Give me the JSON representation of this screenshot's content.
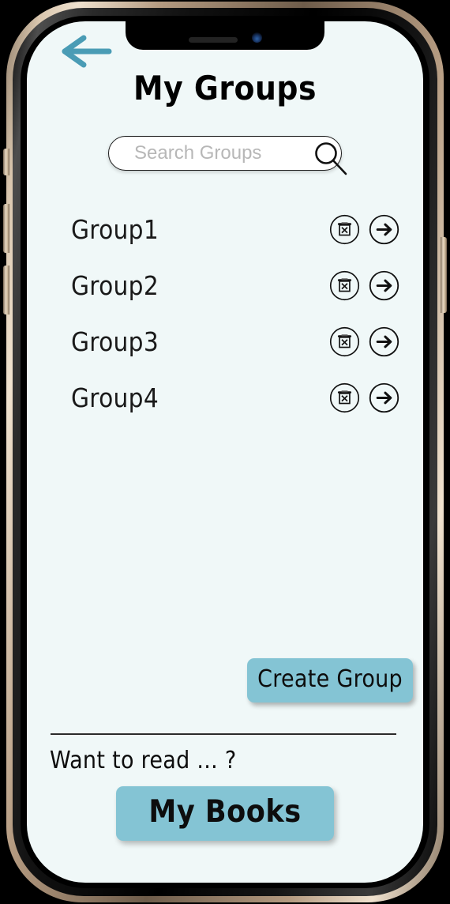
{
  "device": {
    "type": "smartphone-mockup",
    "notch": {
      "speaker": "earpiece-speaker",
      "camera": "front-camera"
    },
    "buttons": [
      "silent-switch",
      "volume-up",
      "volume-down",
      "power"
    ]
  },
  "colors": {
    "screen_background": "#f0f8f8",
    "accent_button": "#84c4d4",
    "back_arrow": "#4a9cb5",
    "text": "#0d0d0d",
    "placeholder": "#b7b7b7"
  },
  "header": {
    "back_label": "Back",
    "title": "My Groups"
  },
  "search": {
    "value": "",
    "placeholder": "Search Groups",
    "icon": "search-icon"
  },
  "groups": [
    {
      "name": "Group1",
      "delete_icon": "trash-delete-icon",
      "open_icon": "arrow-right-icon"
    },
    {
      "name": "Group2",
      "delete_icon": "trash-delete-icon",
      "open_icon": "arrow-right-icon"
    },
    {
      "name": "Group3",
      "delete_icon": "trash-delete-icon",
      "open_icon": "arrow-right-icon"
    },
    {
      "name": "Group4",
      "delete_icon": "trash-delete-icon",
      "open_icon": "arrow-right-icon"
    }
  ],
  "actions": {
    "create_group_label": "Create Group"
  },
  "footer": {
    "prompt": "Want to read ... ?",
    "my_books_label": "My Books"
  }
}
